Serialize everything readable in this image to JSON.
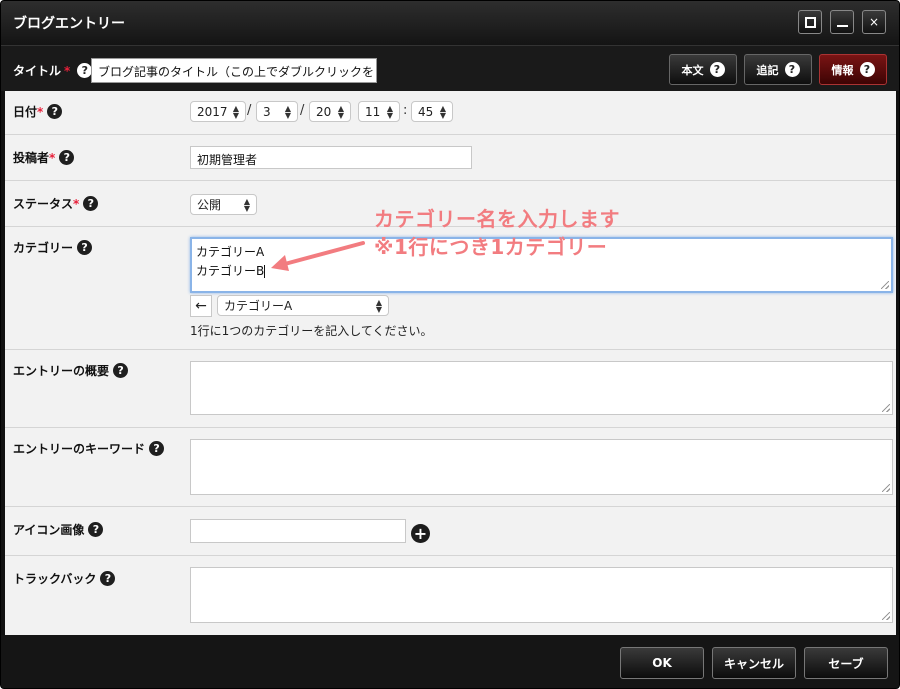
{
  "window": {
    "title": "ブログエントリー",
    "controls": {
      "maximize": "maximize-icon",
      "minimize": "minimize-icon",
      "close": "×"
    }
  },
  "title_row": {
    "label": "タイトル",
    "required": "*",
    "help": "?",
    "value": "ブログ記事のタイトル（この上でダブルクリックをし",
    "tabs": [
      {
        "label": "本文",
        "help": "?"
      },
      {
        "label": "追記",
        "help": "?"
      },
      {
        "label": "情報",
        "help": "?",
        "active": true
      }
    ]
  },
  "date": {
    "label": "日付",
    "required": "*",
    "help": "?",
    "year": "2017",
    "month": "3",
    "day": "20",
    "hour": "11",
    "minute": "45",
    "sep_slash": "/",
    "sep_colon": ":"
  },
  "author": {
    "label": "投稿者",
    "required": "*",
    "help": "?",
    "value": "初期管理者"
  },
  "status": {
    "label": "ステータス",
    "required": "*",
    "help": "?",
    "value": "公開"
  },
  "category": {
    "label": "カテゴリー",
    "help": "?",
    "lines": [
      "カテゴリーA",
      "カテゴリーB"
    ],
    "back_button": "←",
    "select_value": "カテゴリーA",
    "hint": "1行に1つのカテゴリーを記入してください。",
    "annotation_line1": "カテゴリー名を入力します",
    "annotation_line2": "※1行につき1カテゴリー",
    "annotation_color": "#f27c80"
  },
  "summary": {
    "label": "エントリーの概要",
    "help": "?"
  },
  "keywords": {
    "label": "エントリーのキーワード",
    "help": "?"
  },
  "icon_image": {
    "label": "アイコン画像",
    "help": "?",
    "add": "+"
  },
  "trackback": {
    "label": "トラックバック",
    "help": "?"
  },
  "footer": {
    "ok": "OK",
    "cancel": "キャンセル",
    "save": "セーブ"
  },
  "colors": {
    "active_tab": "#7a1414",
    "required": "#e8203a",
    "focus_border": "#8ab4e8"
  }
}
